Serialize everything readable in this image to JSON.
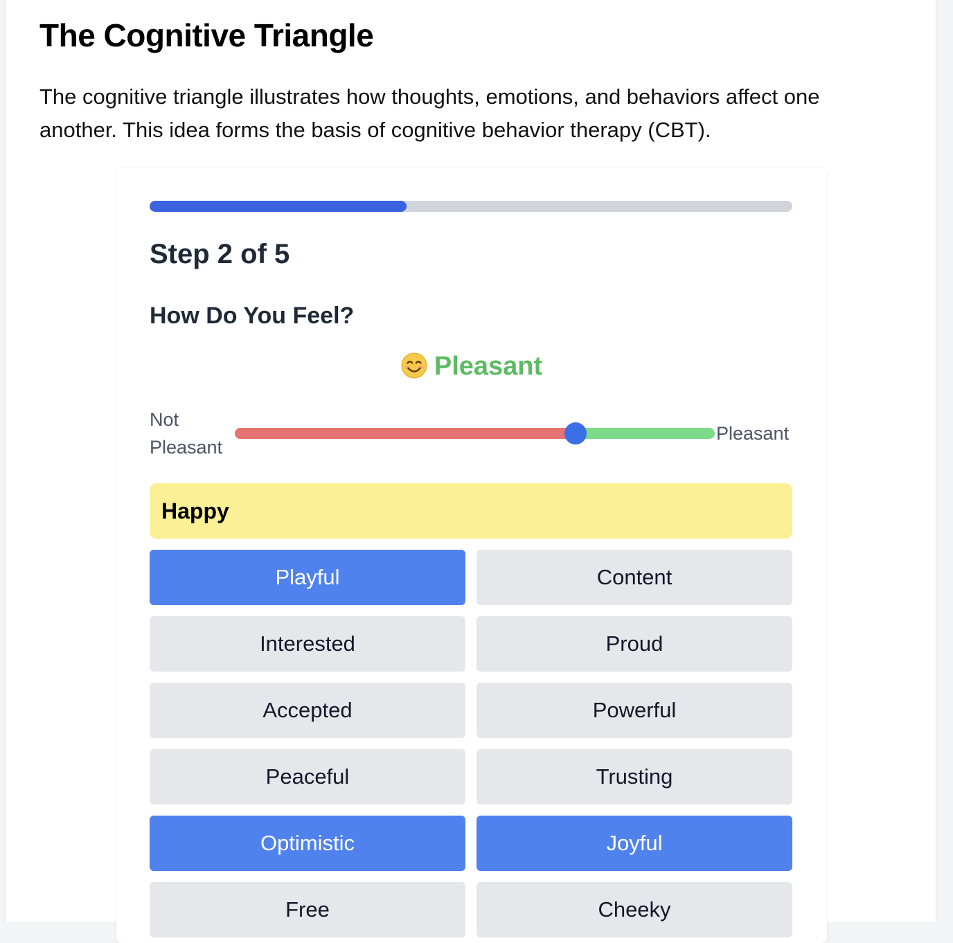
{
  "page": {
    "title": "The Cognitive Triangle",
    "intro": "The cognitive triangle illustrates how thoughts, emotions, and behaviors affect one another. This idea forms the basis of cognitive behavior therapy (CBT)."
  },
  "wizard": {
    "progress": {
      "current_step": 2,
      "total_steps": 5,
      "fraction": 0.4
    },
    "step_label": "Step 2 of 5",
    "question": "How Do You Feel?",
    "mood": {
      "emoji": "smiling-face-icon",
      "label": "Pleasant",
      "color": "#5dbb63"
    },
    "slider": {
      "left_label": "Not Pleasant",
      "right_label": "Pleasant",
      "value": 0.71,
      "negative_color": "#e57373",
      "positive_color": "#7cdb8a",
      "thumb_color": "#3b6fe8"
    },
    "category": {
      "label": "Happy",
      "color": "#fcf097"
    },
    "emotions": [
      {
        "label": "Playful",
        "selected": true
      },
      {
        "label": "Content",
        "selected": false
      },
      {
        "label": "Interested",
        "selected": false
      },
      {
        "label": "Proud",
        "selected": false
      },
      {
        "label": "Accepted",
        "selected": false
      },
      {
        "label": "Powerful",
        "selected": false
      },
      {
        "label": "Peaceful",
        "selected": false
      },
      {
        "label": "Trusting",
        "selected": false
      },
      {
        "label": "Optimistic",
        "selected": true
      },
      {
        "label": "Joyful",
        "selected": true
      },
      {
        "label": "Free",
        "selected": false
      },
      {
        "label": "Cheeky",
        "selected": false
      }
    ],
    "selected_color": "#5082ee",
    "unselected_color": "#e5e7eb"
  }
}
